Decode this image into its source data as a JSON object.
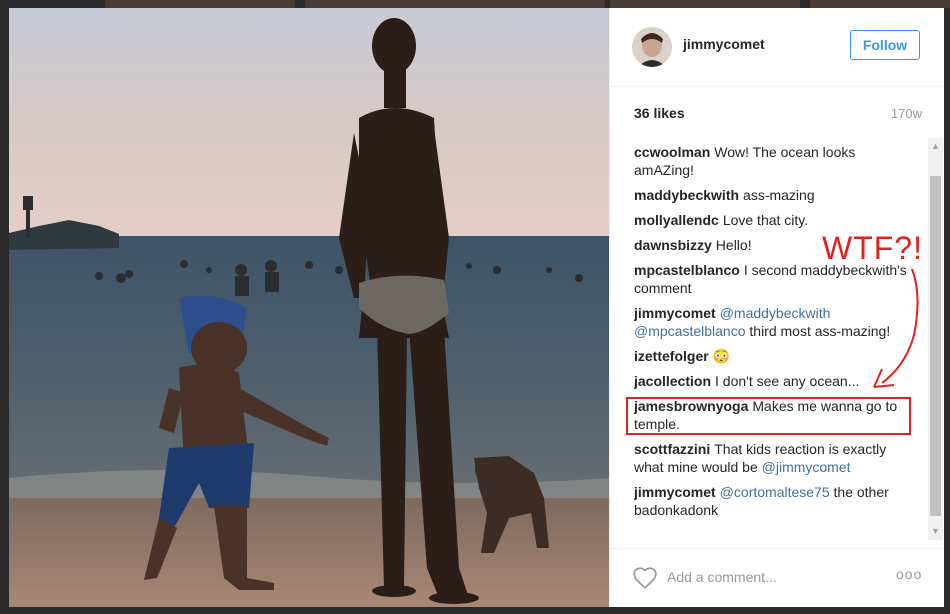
{
  "post": {
    "username": "jimmycomet",
    "follow_label": "Follow",
    "likes": "36 likes",
    "time": "170w",
    "comments": [
      {
        "author": "ccwoolman",
        "parts": [
          {
            "text": "Wow! The ocean looks amAZing!"
          }
        ]
      },
      {
        "author": "maddybeckwith",
        "parts": [
          {
            "text": "ass-mazing"
          }
        ]
      },
      {
        "author": "mollyallendc",
        "parts": [
          {
            "text": "Love that city."
          }
        ]
      },
      {
        "author": "dawnsbizzy",
        "parts": [
          {
            "text": "Hello!"
          }
        ]
      },
      {
        "author": "mpcastelblanco",
        "parts": [
          {
            "text": "I second maddybeckwith's comment"
          }
        ]
      },
      {
        "author": "jimmycomet",
        "parts": [
          {
            "text": "@maddybeckwith @mpcastelblanco",
            "mention": true
          },
          {
            "text": " third most ass-mazing!"
          }
        ]
      },
      {
        "author": "izettefolger",
        "parts": [
          {
            "text": "😳"
          }
        ]
      },
      {
        "author": "jacollection",
        "parts": [
          {
            "text": "I don't see any ocean..."
          }
        ]
      },
      {
        "author": "jamesbrownyoga",
        "parts": [
          {
            "text": "Makes me wanna go to temple."
          }
        ]
      },
      {
        "author": "scottfazzini",
        "parts": [
          {
            "text": "That kids reaction is exactly what mine would be "
          },
          {
            "text": "@jimmycomet",
            "mention": true
          }
        ]
      },
      {
        "author": "jimmycomet",
        "parts": [
          {
            "text": "@cortomaltese75",
            "mention": true
          },
          {
            "text": " the other badonkadonk"
          }
        ]
      }
    ],
    "add_comment_placeholder": "Add a comment...",
    "more_label": "ooo"
  },
  "annotation": {
    "text": "WTF?!",
    "color": "#e0221e"
  },
  "colors": {
    "link": "#3f729b",
    "follow": "#3897f0"
  },
  "icons": {
    "like": "heart-outline-icon",
    "more": "more-options-icon",
    "avatar": "profile-avatar"
  }
}
